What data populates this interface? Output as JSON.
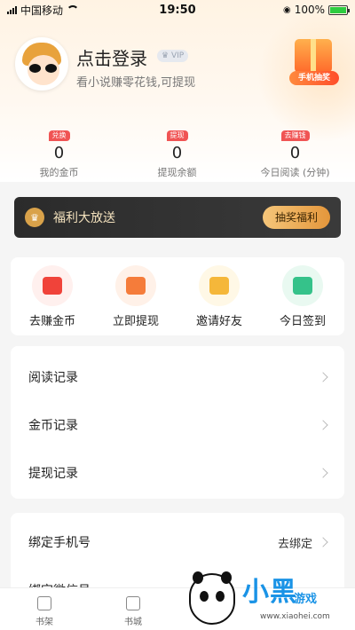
{
  "status_bar": {
    "carrier": "中国移动",
    "time": "19:50",
    "battery": "100%"
  },
  "profile": {
    "login_title": "点击登录",
    "vip_label": "VIP",
    "subtitle": "看小说赚零花钱,可提现",
    "lottery_label": "手机抽奖"
  },
  "stats": [
    {
      "tag": "兑换",
      "value": "0",
      "label": "我的金币"
    },
    {
      "tag": "提现",
      "value": "0",
      "label": "提现余额"
    },
    {
      "tag": "去赚钱",
      "value": "0",
      "label": "今日阅读 (分钟)"
    }
  ],
  "welfare": {
    "title": "福利大放送",
    "button": "抽奖福利"
  },
  "quick_actions": [
    {
      "label": "去赚金币",
      "icon": "red-envelope-icon",
      "color": "#f0433a",
      "bg": "#fff0ee"
    },
    {
      "label": "立即提现",
      "icon": "wallet-icon",
      "color": "#f57c3a",
      "bg": "#fff1e8"
    },
    {
      "label": "邀请好友",
      "icon": "invite-letter-icon",
      "color": "#f5b73a",
      "bg": "#fff8e6"
    },
    {
      "label": "今日签到",
      "icon": "checkin-icon",
      "color": "#35c28a",
      "bg": "#e9f9f1"
    }
  ],
  "menu_records": [
    {
      "label": "阅读记录"
    },
    {
      "label": "金币记录"
    },
    {
      "label": "提现记录"
    }
  ],
  "menu_account": [
    {
      "label": "绑定手机号",
      "value": "去绑定"
    },
    {
      "label": "绑定微信号",
      "value": ""
    }
  ],
  "tabbar": [
    {
      "label": "书架",
      "icon": "bookshelf-icon"
    },
    {
      "label": "书城",
      "icon": "bookstore-icon"
    }
  ],
  "watermark": {
    "brand": "小黑",
    "brand_sub": "游戏",
    "url": "www.xiaohei.com"
  }
}
